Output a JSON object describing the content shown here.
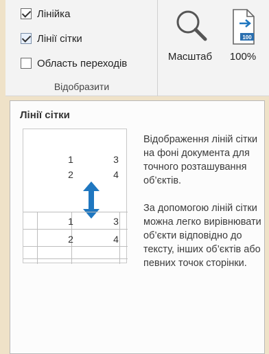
{
  "ribbon": {
    "show_group": {
      "label": "Відобразити",
      "checkboxes": [
        {
          "label": "Лінійка",
          "checked": true
        },
        {
          "label": "Лінії сітки",
          "checked": true
        },
        {
          "label": "Область переходів",
          "checked": false
        }
      ]
    },
    "zoom_group": {
      "zoom_label": "Масштаб",
      "percent_label": "100%",
      "percent_icon_text": "100"
    }
  },
  "tooltip": {
    "title": "Лінії сітки",
    "preview": {
      "top_rows": [
        [
          "1",
          "3"
        ],
        [
          "2",
          "4"
        ]
      ],
      "bottom_rows": [
        [
          "1",
          "3"
        ],
        [
          "2",
          "4"
        ]
      ]
    },
    "paragraph1": "Відображення ліній сітки на фоні документа для точного розташування об’єктів.",
    "paragraph2": "За допомогою ліній сітки можна легко вирівнювати об’єкти відповідно до тексту, інших об’єктів або певних точок сторінки."
  },
  "colors": {
    "accent": "#1a73c7",
    "arrow": "#1f77c0"
  }
}
